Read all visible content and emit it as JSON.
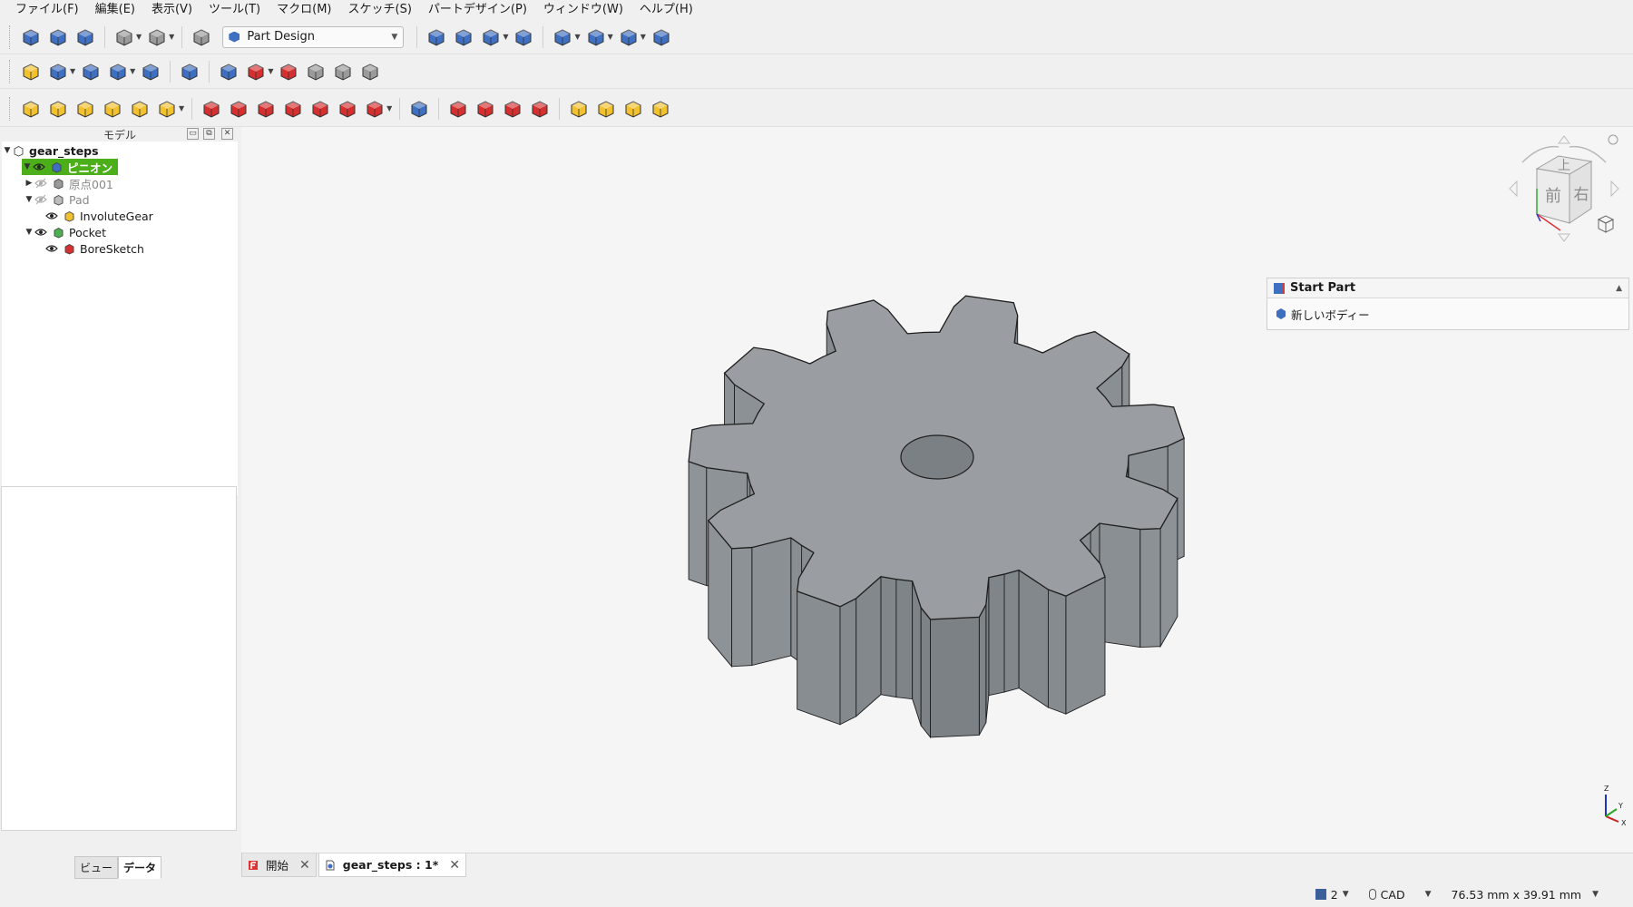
{
  "menubar": [
    "ファイル(F)",
    "編集(E)",
    "表示(V)",
    "ツール(T)",
    "マクロ(M)",
    "スケッチ(S)",
    "パートデザイン(P)",
    "ウィンドウ(W)",
    "ヘルプ(H)"
  ],
  "toolbar": {
    "workbench": "Part Design",
    "icons_row1": [
      "new-document-icon",
      "open-document-icon",
      "save-icon",
      "undo-icon",
      "redo-icon",
      "refresh-icon",
      "fit-all-icon",
      "fit-selection-icon",
      "isometric-view-icon",
      "measure-icon",
      "draw-style-icon",
      "view-box-icon",
      "zoom-icon",
      "measure-tool-icon"
    ],
    "icons_row2": [
      "create-part-icon",
      "create-datum-icon",
      "create-group-icon",
      "link-icon",
      "macro-icon",
      "whats-this-icon",
      "create-body-icon",
      "create-sketch-icon",
      "validate-sketch-icon",
      "shape-binder-icon",
      "clone-icon",
      "sub-shape-binder-icon"
    ],
    "icons_row3": [
      "pad-icon",
      "revolution-icon",
      "additive-loft-icon",
      "additive-pipe-icon",
      "additive-helix-icon",
      "additive-primitive-icon",
      "pocket-icon",
      "hole-icon",
      "groove-icon",
      "subtractive-loft-icon",
      "subtractive-pipe-icon",
      "subtractive-helix-icon",
      "subtractive-primitive-icon",
      "boolean-icon",
      "fillet-icon",
      "chamfer-icon",
      "draft-icon",
      "thickness-icon",
      "mirrored-icon",
      "linear-pattern-icon",
      "polar-pattern-icon",
      "multi-transform-icon"
    ]
  },
  "panel": {
    "title": "モデル",
    "tree": [
      {
        "label": "gear_steps",
        "level": 0,
        "expanded": true
      },
      {
        "label": "ピニオン",
        "level": 1,
        "expanded": true,
        "selected": true
      },
      {
        "label": "原点001",
        "level": 2,
        "expanded": false,
        "muted": true
      },
      {
        "label": "Pad",
        "level": 2,
        "expanded": true,
        "muted": true
      },
      {
        "label": "InvoluteGear",
        "level": 3
      },
      {
        "label": "Pocket",
        "level": 2,
        "expanded": true
      },
      {
        "label": "BoreSketch",
        "level": 3
      }
    ],
    "tabs": [
      "ビュー",
      "データ"
    ]
  },
  "task_panel": {
    "title": "Start Part",
    "item": "新しいボディー"
  },
  "navcube": {
    "top": "上",
    "front": "前",
    "right": "右"
  },
  "axis": {
    "x": "X",
    "y": "Y",
    "z": "Z"
  },
  "doc_tabs": [
    {
      "label": "開始",
      "active": false
    },
    {
      "label": "gear_steps : 1*",
      "active": true
    }
  ],
  "status": {
    "count": "2",
    "nav_style": "CAD",
    "dimensions": "76.53 mm x 39.91 mm"
  },
  "colors": {
    "selection": "#4caf1a",
    "gear_top": "#9a9ea2",
    "gear_side": "#7b8084",
    "edge": "#1e1e1e"
  }
}
